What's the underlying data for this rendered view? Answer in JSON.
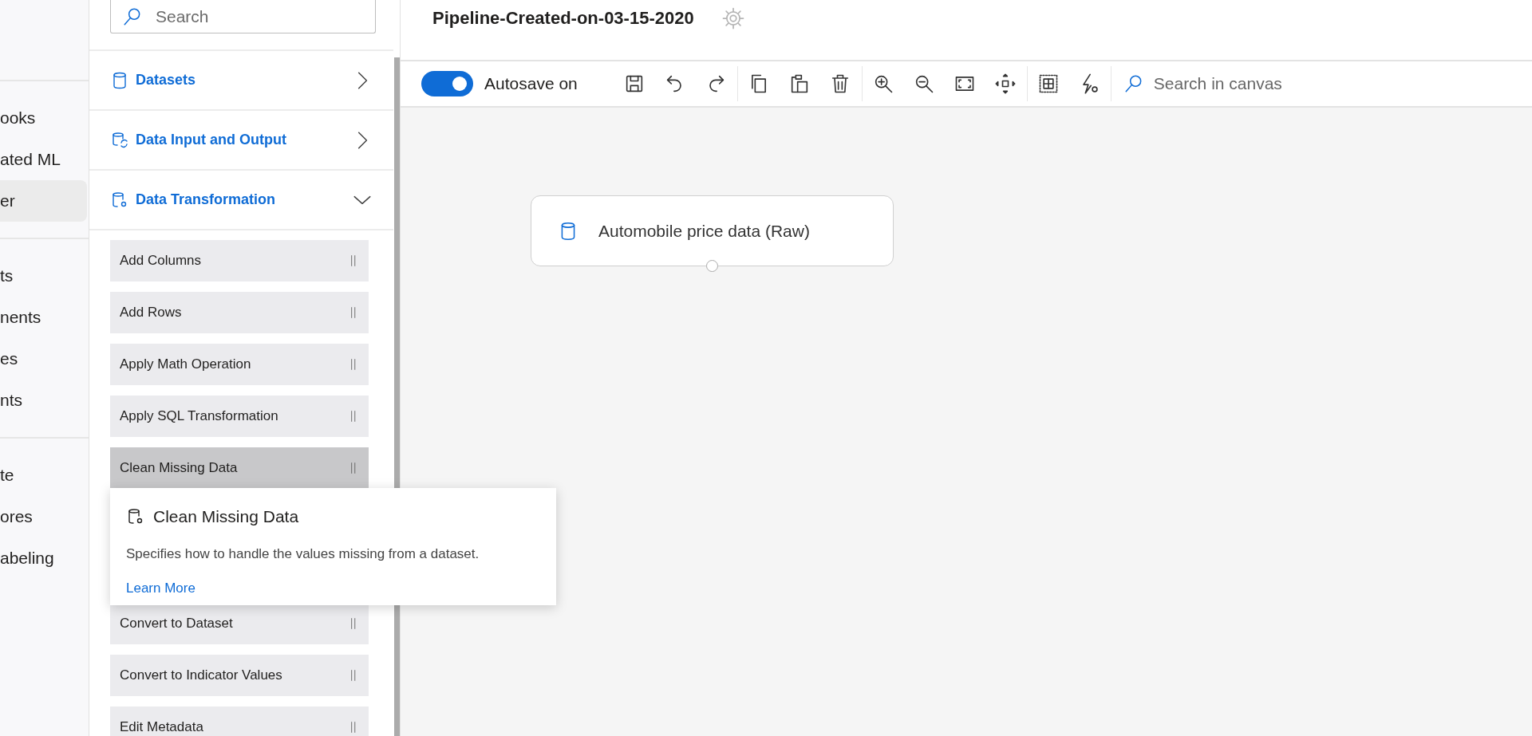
{
  "nav": {
    "groups": [
      [
        {
          "label": "ooks",
          "selected": false
        },
        {
          "label": "ated ML",
          "selected": false
        },
        {
          "label": "er",
          "selected": true
        }
      ],
      [
        {
          "label": "ts",
          "selected": false
        },
        {
          "label": "nents",
          "selected": false
        },
        {
          "label": "es",
          "selected": false
        },
        {
          "label": "nts",
          "selected": false
        }
      ],
      [
        {
          "label": "te",
          "selected": false
        },
        {
          "label": "ores",
          "selected": false
        },
        {
          "label": "abeling",
          "selected": false
        }
      ]
    ]
  },
  "modules": {
    "search": {
      "placeholder": "Search"
    },
    "categories": [
      {
        "label": "Datasets",
        "expanded": false,
        "kind": "dataset"
      },
      {
        "label": "Data Input and Output",
        "expanded": false,
        "kind": "io"
      },
      {
        "label": "Data Transformation",
        "expanded": true,
        "kind": "transform"
      }
    ],
    "items": [
      {
        "label": "Add Columns",
        "hovered": false
      },
      {
        "label": "Add Rows",
        "hovered": false
      },
      {
        "label": "Apply Math Operation",
        "hovered": false
      },
      {
        "label": "Apply SQL Transformation",
        "hovered": false
      },
      {
        "label": "Clean Missing Data",
        "hovered": true
      },
      {
        "label": "Convert to Dataset",
        "hovered": false
      },
      {
        "label": "Convert to Indicator Values",
        "hovered": false
      },
      {
        "label": "Edit Metadata",
        "hovered": false
      }
    ],
    "tooltip": {
      "title": "Clean Missing Data",
      "description": "Specifies how to handle the values missing from a dataset.",
      "link": "Learn More"
    }
  },
  "pipeline": {
    "title": "Pipeline-Created-on-03-15-2020"
  },
  "toolbar": {
    "autosave": {
      "label": "Autosave on",
      "on": true
    },
    "search": {
      "placeholder": "Search in canvas"
    }
  },
  "canvas": {
    "nodes": [
      {
        "label": "Automobile price data (Raw)"
      }
    ]
  }
}
